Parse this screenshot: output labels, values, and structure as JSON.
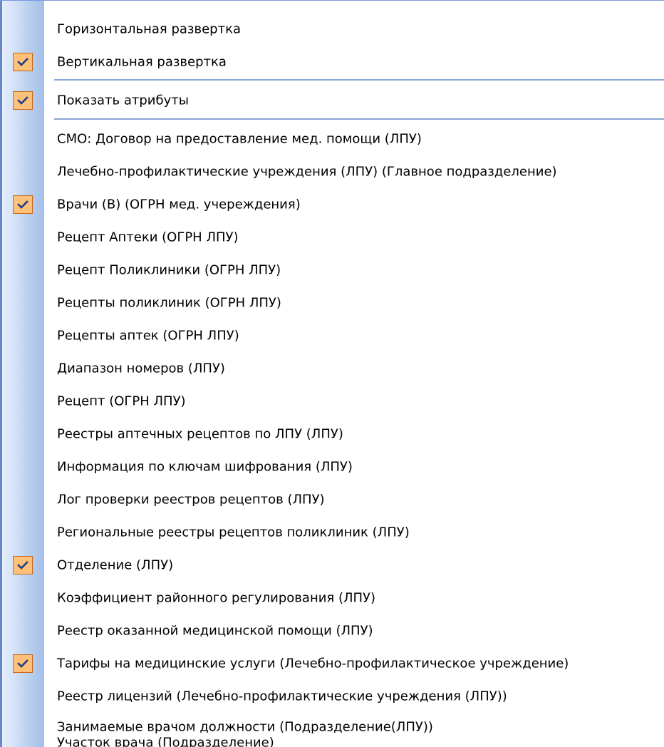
{
  "menu": {
    "section1": [
      {
        "label": "Горизонтальная развертка",
        "checked": false
      },
      {
        "label": "Вертикальная развертка",
        "checked": true
      }
    ],
    "section2": [
      {
        "label": "Показать атрибуты",
        "checked": true
      }
    ],
    "section3": [
      {
        "label": "СМО: Договор на предоставление мед. помощи (ЛПУ)",
        "checked": false
      },
      {
        "label": "Лечебно-профилактические учреждения (ЛПУ) (Главное подразделение)",
        "checked": false
      },
      {
        "label": "Врачи (В) (ОГРН мед. учереждения)",
        "checked": true
      },
      {
        "label": "Рецепт Аптеки (ОГРН ЛПУ)",
        "checked": false
      },
      {
        "label": "Рецепт Поликлиники (ОГРН ЛПУ)",
        "checked": false
      },
      {
        "label": "Рецепты поликлиник (ОГРН ЛПУ)",
        "checked": false
      },
      {
        "label": "Рецепты аптек (ОГРН ЛПУ)",
        "checked": false
      },
      {
        "label": "Диапазон номеров (ЛПУ)",
        "checked": false
      },
      {
        "label": "Рецепт (ОГРН ЛПУ)",
        "checked": false
      },
      {
        "label": "Реестры аптечных рецептов по ЛПУ (ЛПУ)",
        "checked": false
      },
      {
        "label": "Информация по ключам шифрования (ЛПУ)",
        "checked": false
      },
      {
        "label": "Лог проверки реестров рецептов (ЛПУ)",
        "checked": false
      },
      {
        "label": "Региональные реестры рецептов поликлиник (ЛПУ)",
        "checked": false
      },
      {
        "label": "Отделение (ЛПУ)",
        "checked": true
      },
      {
        "label": "Коэффициент  районного регулирования (ЛПУ)",
        "checked": false
      },
      {
        "label": "Реестр оказанной медицинской помощи (ЛПУ)",
        "checked": false
      },
      {
        "label": "Тарифы на медицинские услуги (Лечебно-профилактическое учреждение)",
        "checked": true
      },
      {
        "label": "Реестр лицензий (Лечебно-профилактические учреждения (ЛПУ))",
        "checked": false
      },
      {
        "label": "Занимаемые врачом должности (Подразделение(ЛПУ))",
        "checked": false
      },
      {
        "label": "Участок врача (Подразделение)",
        "checked": false
      }
    ]
  },
  "colors": {
    "check_fill": "#ffc07a",
    "check_border": "#c66a1c",
    "check_mark": "#1f3f86",
    "separator": "#8aa6d6"
  },
  "icons": {
    "checked": "checkmark-icon"
  }
}
